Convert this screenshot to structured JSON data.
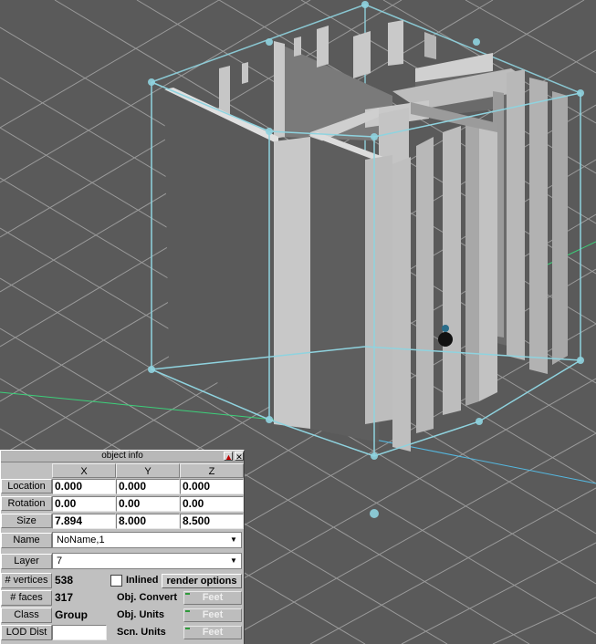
{
  "viewport": {
    "background": "#5a5a5a",
    "grid_color": "#9a9a9a",
    "bbox_color": "#8fd3df",
    "wall_dark": "#5c5c5c",
    "wall_light": "#bdbdbd"
  },
  "panel": {
    "title": "object info",
    "collapse_icon": "triangle-up-icon",
    "close_icon": "close-icon",
    "col_x": "X",
    "col_y": "Y",
    "col_z": "Z",
    "location_label": "Location",
    "location": {
      "x": "0.000",
      "y": "0.000",
      "z": "0.000"
    },
    "rotation_label": "Rotation",
    "rotation": {
      "x": "0.00",
      "y": "0.00",
      "z": "0.00"
    },
    "size_label": "Size",
    "size": {
      "x": "7.894",
      "y": "8.000",
      "z": "8.500"
    },
    "name_label": "Name",
    "name_value": "NoName,1",
    "layer_label": "Layer",
    "layer_value": "7",
    "vertices_label": "# vertices",
    "vertices_value": "538",
    "inlined_label": "Inlined",
    "inlined_checked": false,
    "render_options_label": "render options",
    "faces_label": "# faces",
    "faces_value": "317",
    "obj_convert_label": "Obj. Convert",
    "obj_convert_value": "Feet",
    "class_label": "Class",
    "class_value": "Group",
    "obj_units_label": "Obj. Units",
    "obj_units_value": "Feet",
    "lod_label": "LOD Dist",
    "lod_value": "",
    "scn_units_label": "Scn. Units",
    "scn_units_value": "Feet"
  }
}
